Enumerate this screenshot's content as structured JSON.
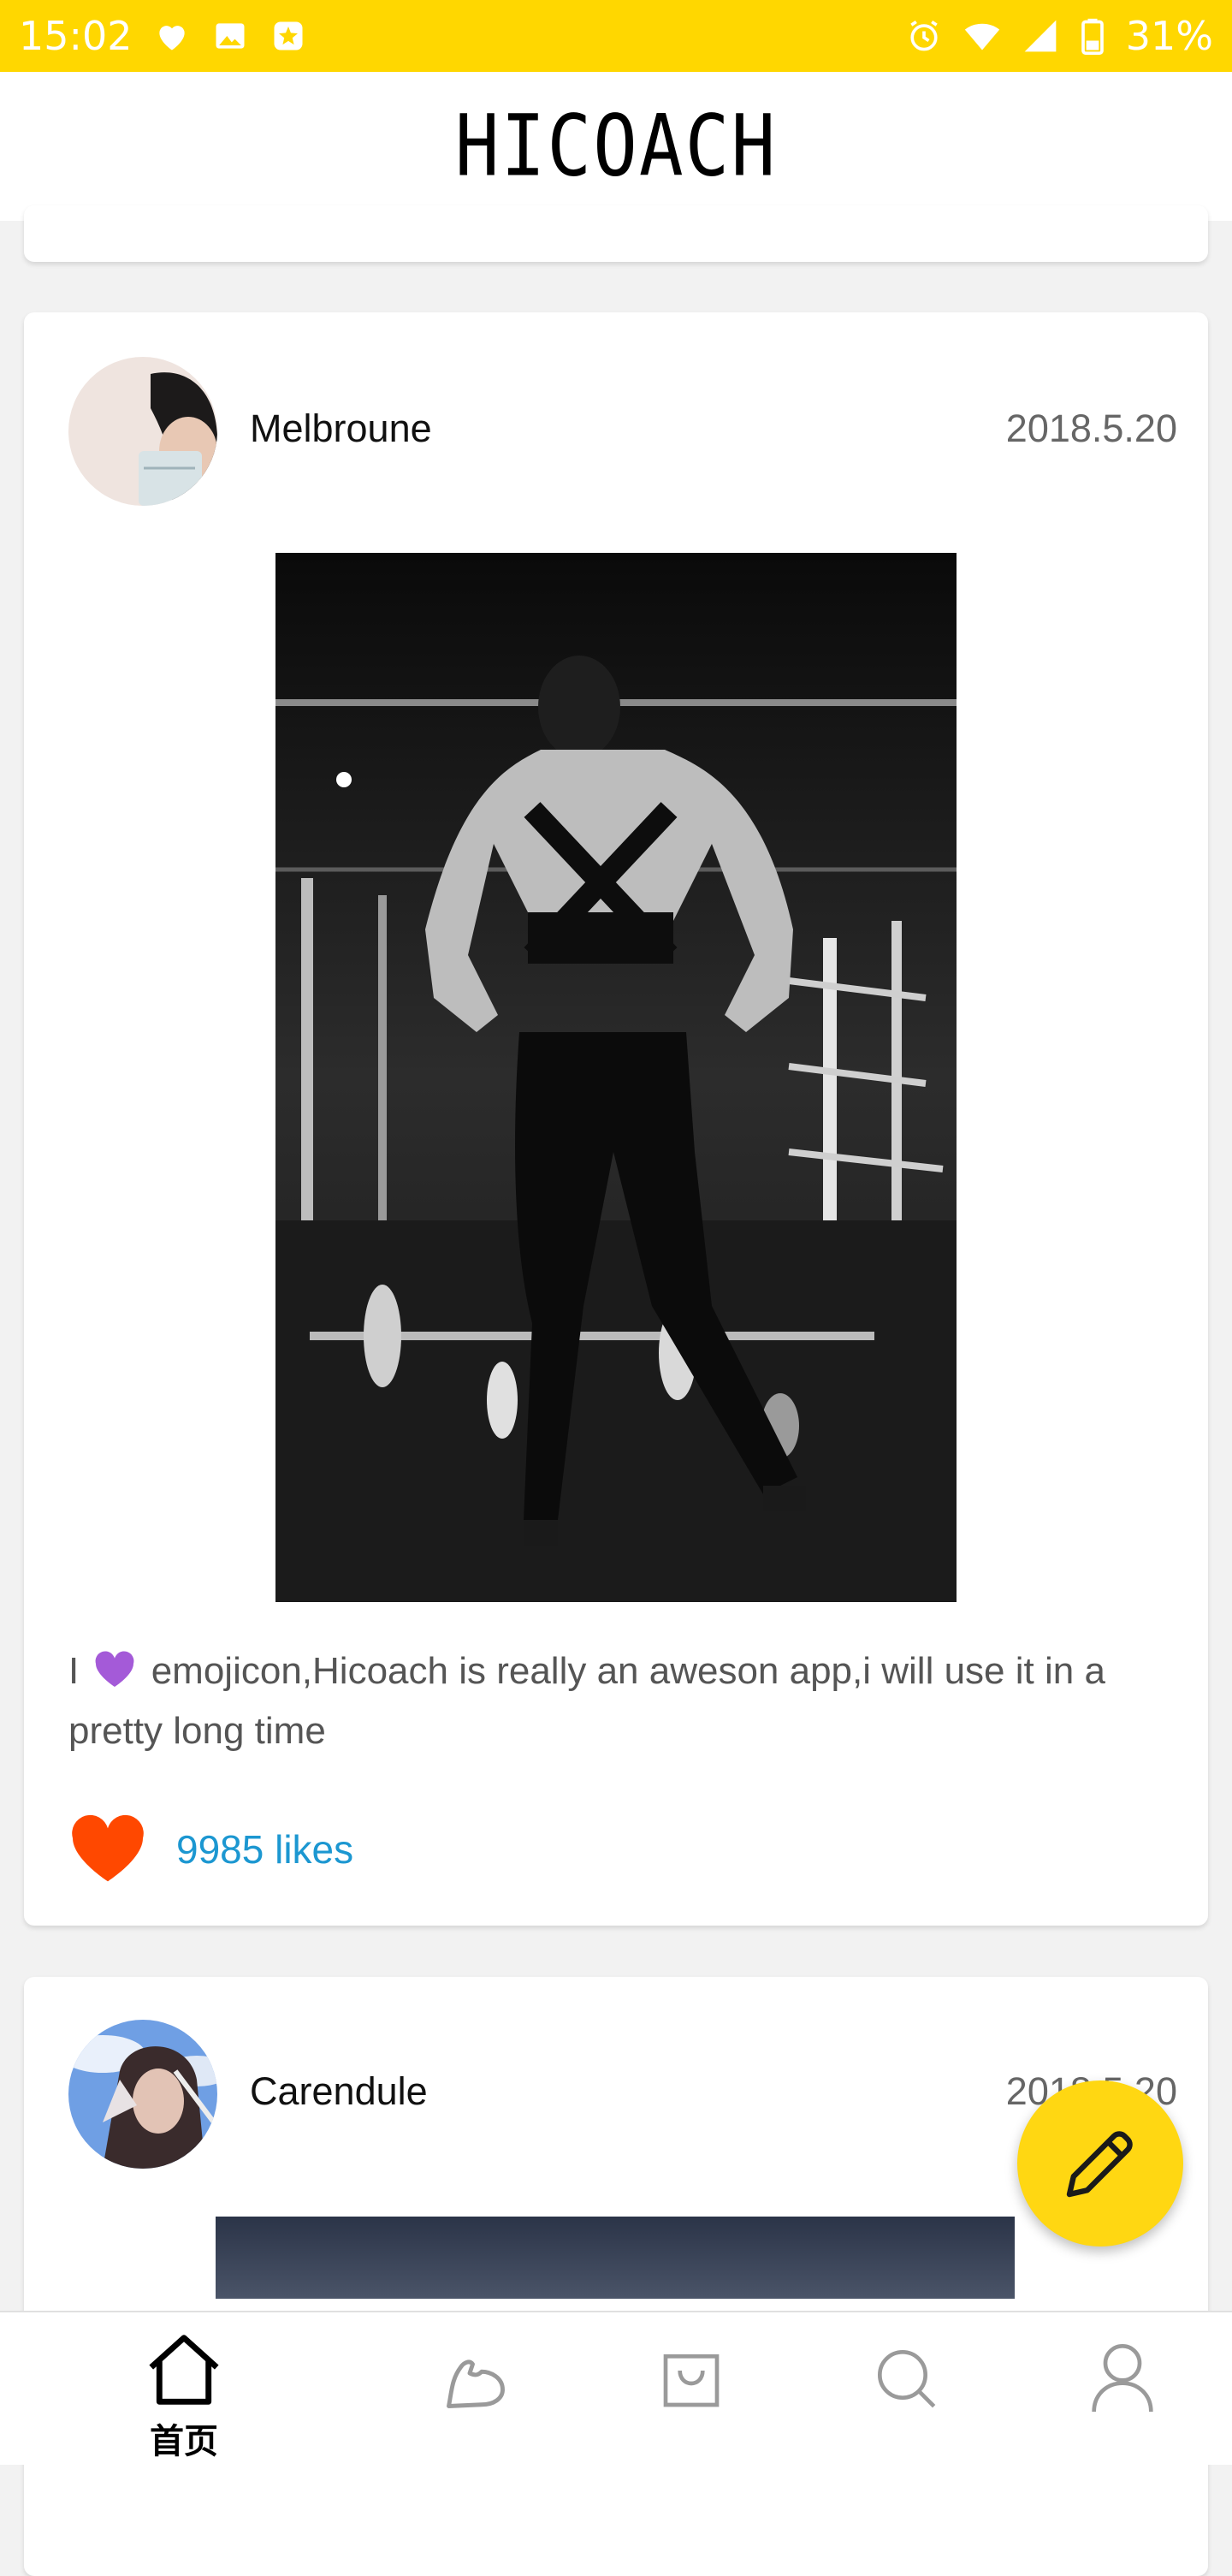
{
  "status_bar": {
    "time": "15:02",
    "battery": "31%",
    "left_icons": [
      "heart-icon",
      "image-icon",
      "sparkle-badge-icon"
    ],
    "right_icons": [
      "alarm-icon",
      "wifi-icon",
      "signal-icon",
      "battery-icon"
    ],
    "background_color": "#ffd700"
  },
  "header": {
    "title": "HICOACH"
  },
  "posts": [
    {
      "username": "Melbroune",
      "date": "2018.5.20",
      "caption_before": "I",
      "caption_after": "emojicon,Hicoach is really an aweson app,i will use it in a pretty long time",
      "caption_emoji": "purple-heart-emoji",
      "likes": "9985 likes",
      "like_color": "#ff4800"
    },
    {
      "username": "Carendule",
      "date": "2018.5.20"
    }
  ],
  "fab": {
    "icon": "pencil-icon",
    "color": "#ffd712"
  },
  "bottom_nav": {
    "items": [
      {
        "icon": "home-icon",
        "label": "首页",
        "active": true
      },
      {
        "icon": "muscle-arm-icon",
        "label": "",
        "active": false
      },
      {
        "icon": "shopping-bag-icon",
        "label": "",
        "active": false
      },
      {
        "icon": "search-icon",
        "label": "",
        "active": false
      },
      {
        "icon": "profile-icon",
        "label": "",
        "active": false
      }
    ]
  }
}
